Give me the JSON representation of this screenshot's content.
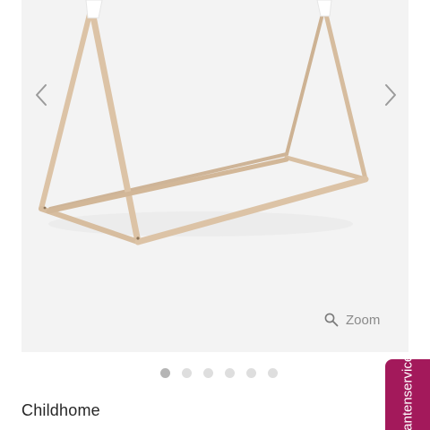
{
  "gallery": {
    "product_image_alt": "Childhome tipi bed frame",
    "prev_icon": "chevron-left-icon",
    "next_icon": "chevron-right-icon",
    "zoom_icon": "magnifier-icon",
    "zoom_label": "Zoom",
    "slide_count": 6,
    "active_slide": 1
  },
  "product": {
    "brand": "Childhome"
  },
  "service_tab": {
    "label": "Klantenservice"
  },
  "colors": {
    "image_background": "#f3f3f3",
    "wood": "#dcc3a6",
    "tip_white": "#ffffff",
    "service_accent": "#a3195b",
    "dot_active": "#b5b5b5",
    "dot_inactive": "#dedede"
  }
}
